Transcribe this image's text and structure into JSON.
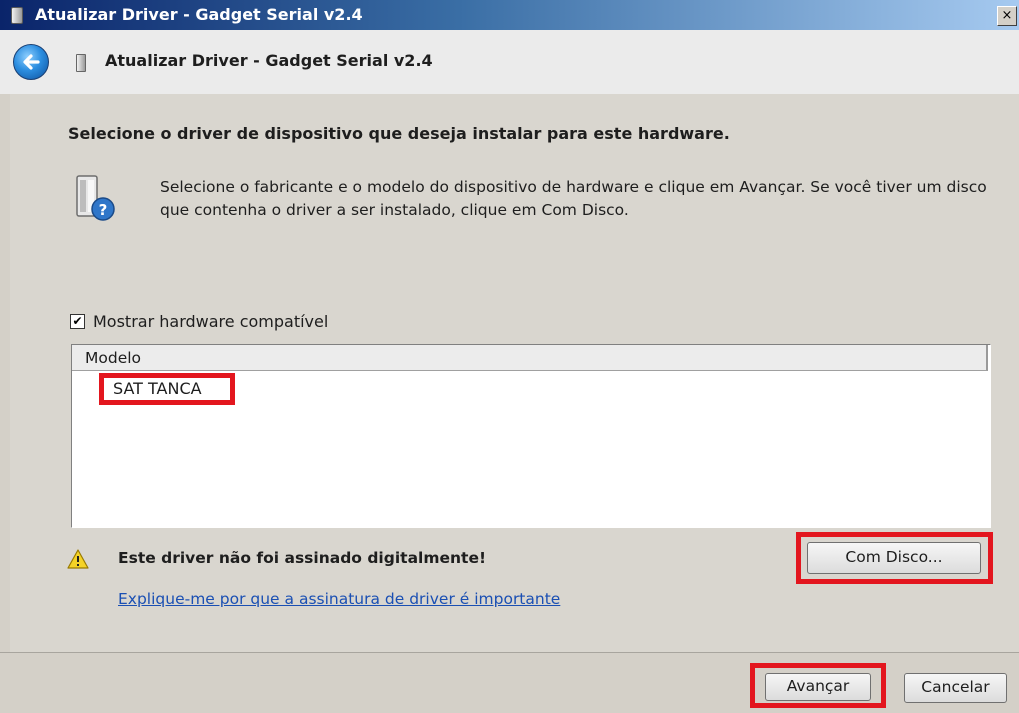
{
  "window": {
    "title": "Atualizar Driver -  Gadget Serial v2.4",
    "close_glyph": "×"
  },
  "nav": {
    "title": "Atualizar Driver -  Gadget Serial v2.4",
    "back_icon": "back-arrow-icon"
  },
  "content": {
    "heading": "Selecione o driver de dispositivo que deseja instalar para este hardware.",
    "instructions": "Selecione o fabricante e o modelo do dispositivo de hardware e clique em Avançar. Se você tiver um disco que contenha o driver a ser instalado, clique em Com Disco.",
    "show_compatible": {
      "label": "Mostrar hardware compatível",
      "checked": true,
      "check_glyph": "✔"
    },
    "list": {
      "column_header": "Modelo",
      "items": [
        "SAT TANCA"
      ]
    },
    "warning": {
      "text": "Este driver não foi assinado digitalmente!",
      "link": "Explique-me por que a assinatura de driver é importante"
    },
    "com_disco_label": "Com Disco..."
  },
  "footer": {
    "next_label": "Avançar",
    "cancel_label": "Cancelar"
  },
  "colors": {
    "highlight_box": "#e3161e",
    "link": "#1a4fb3",
    "title_bar": "#0a246a"
  }
}
